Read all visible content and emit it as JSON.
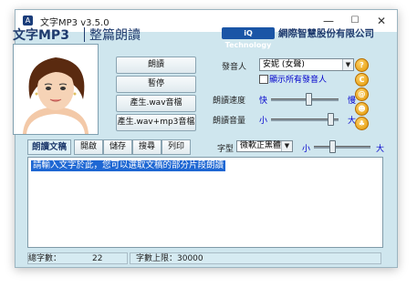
{
  "window": {
    "title": "文字MP3 v3.5.0",
    "minimize": "—",
    "maximize": "☐",
    "close": "✕",
    "icon_label": "A"
  },
  "header": {
    "app_title": "文字MP3",
    "subtitle": "整篇朗讀",
    "logo_text": "iQ Technology",
    "company": "網際智慧股份有限公司"
  },
  "buttons": {
    "read": "朗讀",
    "pause": "暫停",
    "make_wav": "產生.wav音檔",
    "make_wav_mp3": "產生.wav+mp3音檔"
  },
  "voice": {
    "label": "發音人",
    "selected": "安妮 (女聲)",
    "show_all_label": "顯示所有發音人"
  },
  "speed": {
    "label": "朗讀速度",
    "fast": "快",
    "slow": "慢",
    "level": 0.55
  },
  "volume": {
    "label": "朗讀音量",
    "small": "小",
    "big": "大",
    "level": 0.9
  },
  "side_icons": [
    "help-icon",
    "copyright-icon",
    "email-icon",
    "person-icon",
    "settings-icon"
  ],
  "side_icon_glyphs": [
    "?",
    "C",
    "@",
    "☻",
    "♣"
  ],
  "toolbar": {
    "tab_label": "朗讀文稿",
    "open": "開啟",
    "save": "儲存",
    "search": "搜尋",
    "print": "列印",
    "font_label": "字型",
    "font_selected": "微軟正黑體",
    "size_small": "小",
    "size_big": "大",
    "size_level": 0.3
  },
  "editor": {
    "text": "請輸入文字於此，您可以選取文稿的部分片段朗讀"
  },
  "status": {
    "count_label": "總字數：",
    "count_value": "22",
    "limit_text": "字數上限：30000"
  }
}
